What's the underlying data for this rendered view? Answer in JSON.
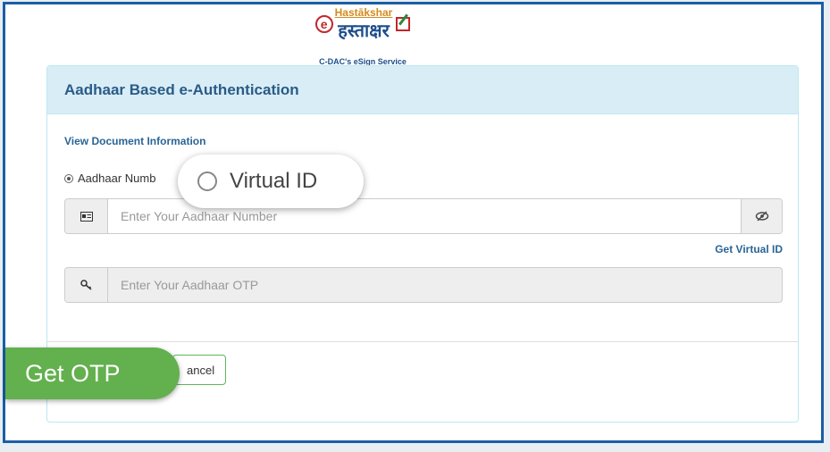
{
  "logo": {
    "english": "Hastākshar",
    "hindi": "हस्ताक्षर",
    "tagline": "C-DAC's eSign Service"
  },
  "panel": {
    "title": "Aadhaar Based e-Authentication",
    "view_document_link": "View Document Information"
  },
  "auth_options": {
    "aadhaar_label": "Aadhaar Numb",
    "aadhaar_selected": true,
    "virtual_id_label": "Virtual ID",
    "virtual_id_selected": false
  },
  "aadhaar_input": {
    "placeholder": "Enter Your Aadhaar Number",
    "value": ""
  },
  "get_virtual_id_link": "Get Virtual ID",
  "otp_input": {
    "placeholder": "Enter Your Aadhaar OTP",
    "value": ""
  },
  "buttons": {
    "get_otp": "Get OTP",
    "cancel": "ancel"
  },
  "colors": {
    "frame_border": "#1a5ea8",
    "panel_header_bg": "#d9edf7",
    "accent_green": "#63b04e",
    "link_blue": "#2a6496"
  },
  "icons": {
    "id_card": "id-card-icon",
    "eye_slash": "eye-slash-icon",
    "key": "key-icon"
  }
}
